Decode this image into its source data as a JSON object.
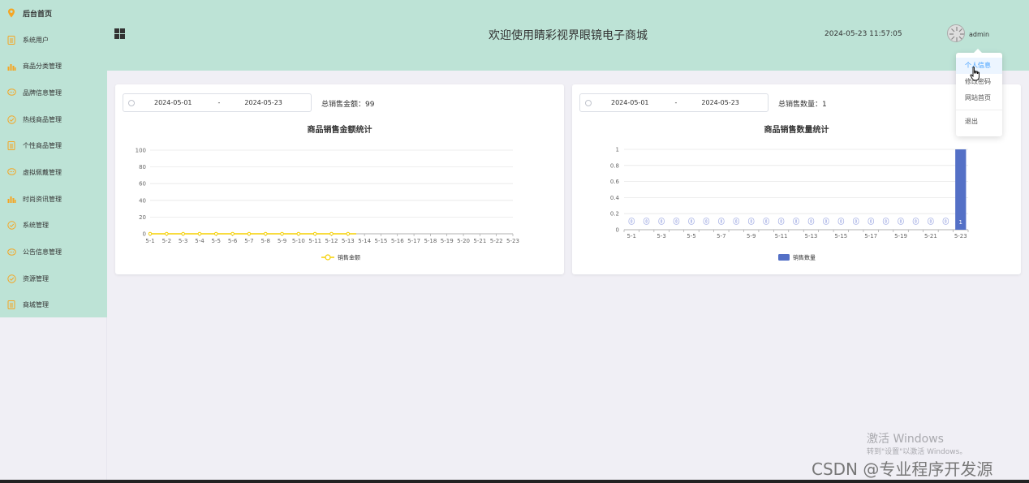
{
  "sidebar": {
    "items": [
      {
        "label": "后台首页",
        "icon": "location-pin-icon",
        "active": true
      },
      {
        "label": "系统用户",
        "icon": "document-icon"
      },
      {
        "label": "商品分类管理",
        "icon": "bar-chart-icon"
      },
      {
        "label": "品牌信息管理",
        "icon": "chat-bubble-icon"
      },
      {
        "label": "热线商品管理",
        "icon": "check-circle-icon"
      },
      {
        "label": "个性商品管理",
        "icon": "document-icon"
      },
      {
        "label": "虚拟佩戴管理",
        "icon": "chat-bubble-icon"
      },
      {
        "label": "时尚资讯管理",
        "icon": "bar-chart-icon"
      },
      {
        "label": "系统管理",
        "icon": "check-circle-icon"
      },
      {
        "label": "公告信息管理",
        "icon": "chat-bubble-icon"
      },
      {
        "label": "资源管理",
        "icon": "check-circle-icon"
      },
      {
        "label": "商城管理",
        "icon": "document-icon"
      }
    ]
  },
  "header": {
    "title": "欢迎使用睛彩视界眼镜电子商城",
    "datetime": "2024-05-23 11:57:05",
    "username": "admin"
  },
  "user_menu": {
    "items": [
      "个人信息",
      "修改密码",
      "网站首页"
    ],
    "logout": "退出"
  },
  "cards": [
    {
      "date_start": "2024-05-01",
      "date_sep": "-",
      "date_end": "2024-05-23",
      "total_label": "总销售金额：99"
    },
    {
      "date_start": "2024-05-01",
      "date_sep": "-",
      "date_end": "2024-05-23",
      "total_label": "总销售数量：1"
    }
  ],
  "chart_data": [
    {
      "type": "line",
      "title": "商品销售金额统计",
      "categories": [
        "5-1",
        "5-2",
        "5-3",
        "5-4",
        "5-5",
        "5-6",
        "5-7",
        "5-8",
        "5-9",
        "5-10",
        "5-11",
        "5-12",
        "5-13",
        "5-14",
        "5-15",
        "5-16",
        "5-17",
        "5-18",
        "5-19",
        "5-20",
        "5-21",
        "5-22",
        "5-23"
      ],
      "series": [
        {
          "name": "销售金额",
          "values": [
            0,
            0,
            0,
            0,
            0,
            0,
            0,
            0,
            0,
            0,
            0,
            0,
            0,
            null,
            null,
            null,
            null,
            null,
            null,
            null,
            null,
            null,
            null
          ]
        }
      ],
      "yticks": [
        "0",
        "20",
        "40",
        "60",
        "80",
        "100"
      ],
      "ylim": [
        0,
        100
      ],
      "color": "#f5d000",
      "grid": true,
      "legend": "bottom"
    },
    {
      "type": "bar",
      "title": "商品销售数量统计",
      "categories": [
        "5-1",
        "5-2",
        "5-3",
        "5-4",
        "5-5",
        "5-6",
        "5-7",
        "5-8",
        "5-9",
        "5-10",
        "5-11",
        "5-12",
        "5-13",
        "5-14",
        "5-15",
        "5-16",
        "5-17",
        "5-18",
        "5-19",
        "5-20",
        "5-21",
        "5-22",
        "5-23"
      ],
      "xtick_labels": [
        "5-1",
        "5-3",
        "5-5",
        "5-7",
        "5-9",
        "5-11",
        "5-13",
        "5-15",
        "5-17",
        "5-19",
        "5-21",
        "5-23"
      ],
      "series": [
        {
          "name": "销售数量",
          "values": [
            0,
            0,
            0,
            0,
            0,
            0,
            0,
            0,
            0,
            0,
            0,
            0,
            0,
            0,
            0,
            0,
            0,
            0,
            0,
            0,
            0,
            0,
            1
          ]
        }
      ],
      "data_labels": [
        "0",
        "0",
        "0",
        "0",
        "0",
        "0",
        "0",
        "0",
        "0",
        "0",
        "0",
        "0",
        "0",
        "0",
        "0",
        "0",
        "0",
        "0",
        "0",
        "0",
        "0",
        "0",
        "1"
      ],
      "yticks": [
        "0",
        "0.2",
        "0.4",
        "0.6",
        "0.8",
        "1"
      ],
      "ylim": [
        0,
        1
      ],
      "color": "#5470c6",
      "grid": true,
      "legend": "bottom"
    }
  ],
  "watermark": {
    "line1": "激活 Windows",
    "line2": "转到\"设置\"以激活 Windows。",
    "csdn": "CSDN @专业程序开发源"
  }
}
